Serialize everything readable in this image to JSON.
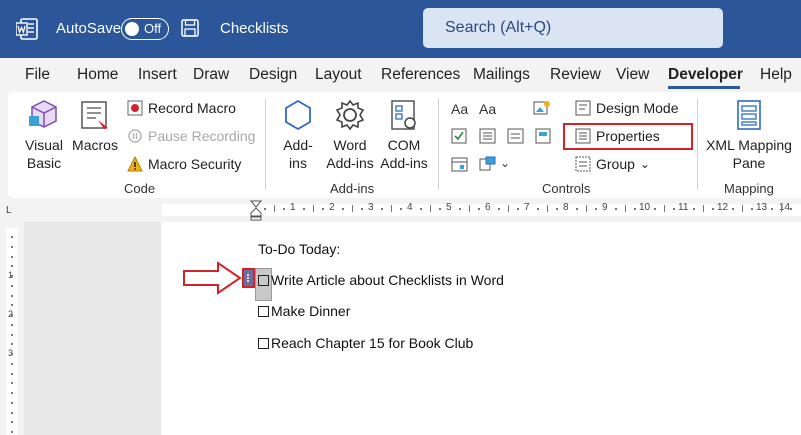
{
  "titlebar": {
    "autosave_label": "AutoSave",
    "autosave_state": "Off",
    "doc_title": "Checklists",
    "search_placeholder": "Search (Alt+Q)"
  },
  "menu": {
    "tabs": [
      "File",
      "Home",
      "Insert",
      "Draw",
      "Design",
      "Layout",
      "References",
      "Mailings",
      "Review",
      "View",
      "Developer",
      "Help"
    ],
    "active_tab": "Developer"
  },
  "ribbon": {
    "code": {
      "label": "Code",
      "visual_basic": "Visual Basic",
      "macros": "Macros",
      "record_macro": "Record Macro",
      "pause_recording": "Pause Recording",
      "macro_security": "Macro Security"
    },
    "addins": {
      "label": "Add-ins",
      "addins": "Add-ins",
      "word_addins": "Word Add-ins",
      "com_addins": "COM Add-ins"
    },
    "controls": {
      "label": "Controls",
      "design_mode": "Design Mode",
      "properties": "Properties",
      "group": "Group"
    },
    "mapping": {
      "label": "Mapping",
      "xml_mapping_pane": "XML Mapping Pane"
    }
  },
  "ruler": {
    "numbers": [
      "1",
      "2",
      "3",
      "4",
      "5",
      "6",
      "7",
      "8",
      "9",
      "10",
      "11",
      "12",
      "13",
      "14"
    ],
    "vertical_numbers": [
      "1",
      "2",
      "3"
    ]
  },
  "document": {
    "heading": "To-Do Today:",
    "items": [
      "Write Article about Checklists in Word",
      "Make Dinner",
      "Reach Chapter 15 for Book Club"
    ]
  },
  "colors": {
    "titlebar": "#2b579a",
    "highlight": "#d3232a"
  }
}
